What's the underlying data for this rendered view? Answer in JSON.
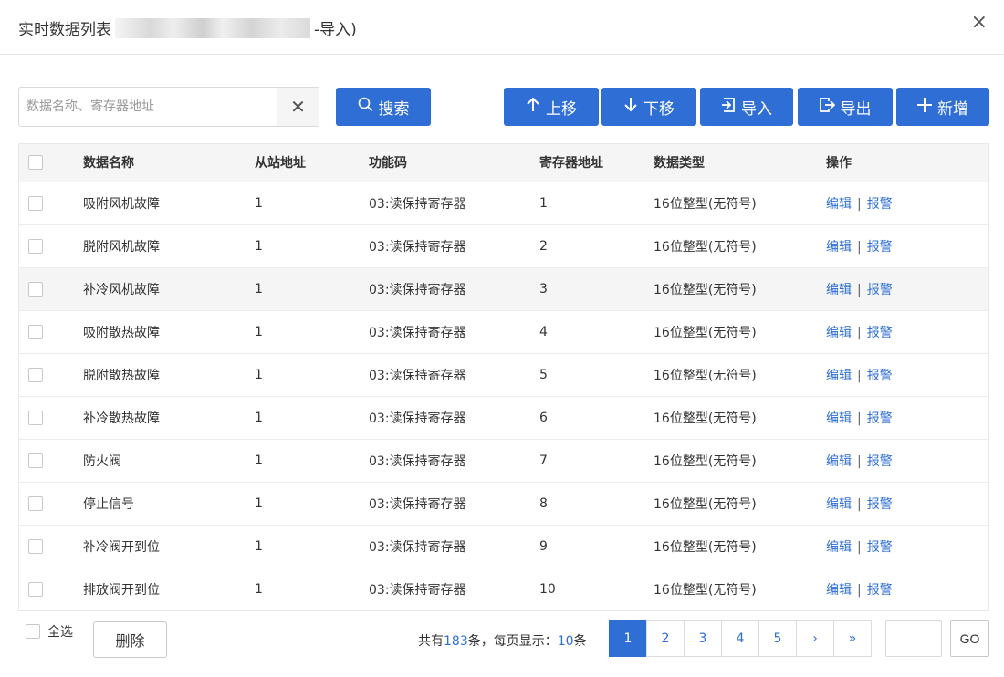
{
  "header": {
    "title_prefix": "实时数据列表",
    "title_suffix": "-导入)",
    "close_glyph": "×"
  },
  "search": {
    "placeholder": "数据名称、寄存器地址",
    "value": "",
    "clear_glyph": "✕",
    "button_icon": "search-icon",
    "button_label": "搜索"
  },
  "toolbar": {
    "move_up_label": "上移",
    "move_down_label": "下移",
    "import_label": "导入",
    "export_label": "导出",
    "add_label": "新增"
  },
  "table": {
    "columns": [
      "数据名称",
      "从站地址",
      "功能码",
      "寄存器地址",
      "数据类型",
      "操作"
    ],
    "action_edit": "编辑",
    "action_alarm": "报警",
    "action_separator": "|",
    "rows": [
      {
        "name": "吸附风机故障",
        "slave": "1",
        "func": "03:读保持寄存器",
        "reg": "1",
        "type": "16位整型(无符号)"
      },
      {
        "name": "脱附风机故障",
        "slave": "1",
        "func": "03:读保持寄存器",
        "reg": "2",
        "type": "16位整型(无符号)"
      },
      {
        "name": "补冷风机故障",
        "slave": "1",
        "func": "03:读保持寄存器",
        "reg": "3",
        "type": "16位整型(无符号)"
      },
      {
        "name": "吸附散热故障",
        "slave": "1",
        "func": "03:读保持寄存器",
        "reg": "4",
        "type": "16位整型(无符号)"
      },
      {
        "name": "脱附散热故障",
        "slave": "1",
        "func": "03:读保持寄存器",
        "reg": "5",
        "type": "16位整型(无符号)"
      },
      {
        "name": "补冷散热故障",
        "slave": "1",
        "func": "03:读保持寄存器",
        "reg": "6",
        "type": "16位整型(无符号)"
      },
      {
        "name": "防火阀",
        "slave": "1",
        "func": "03:读保持寄存器",
        "reg": "7",
        "type": "16位整型(无符号)"
      },
      {
        "name": "停止信号",
        "slave": "1",
        "func": "03:读保持寄存器",
        "reg": "8",
        "type": "16位整型(无符号)"
      },
      {
        "name": "补冷阀开到位",
        "slave": "1",
        "func": "03:读保持寄存器",
        "reg": "9",
        "type": "16位整型(无符号)"
      },
      {
        "name": "排放阀开到位",
        "slave": "1",
        "func": "03:读保持寄存器",
        "reg": "10",
        "type": "16位整型(无符号)"
      }
    ]
  },
  "footer": {
    "select_all_label": "全选",
    "delete_label": "删除",
    "total_prefix": "共有",
    "total_count": "183",
    "total_mid": "条，每页显示：",
    "page_size": "10",
    "total_suffix": "条",
    "pages": [
      "1",
      "2",
      "3",
      "4",
      "5",
      "›",
      "»"
    ],
    "active_page": "1",
    "goto_value": "",
    "go_label": "GO"
  },
  "colors": {
    "primary": "#2f6ed4",
    "header_bg": "#f5f5f5"
  }
}
